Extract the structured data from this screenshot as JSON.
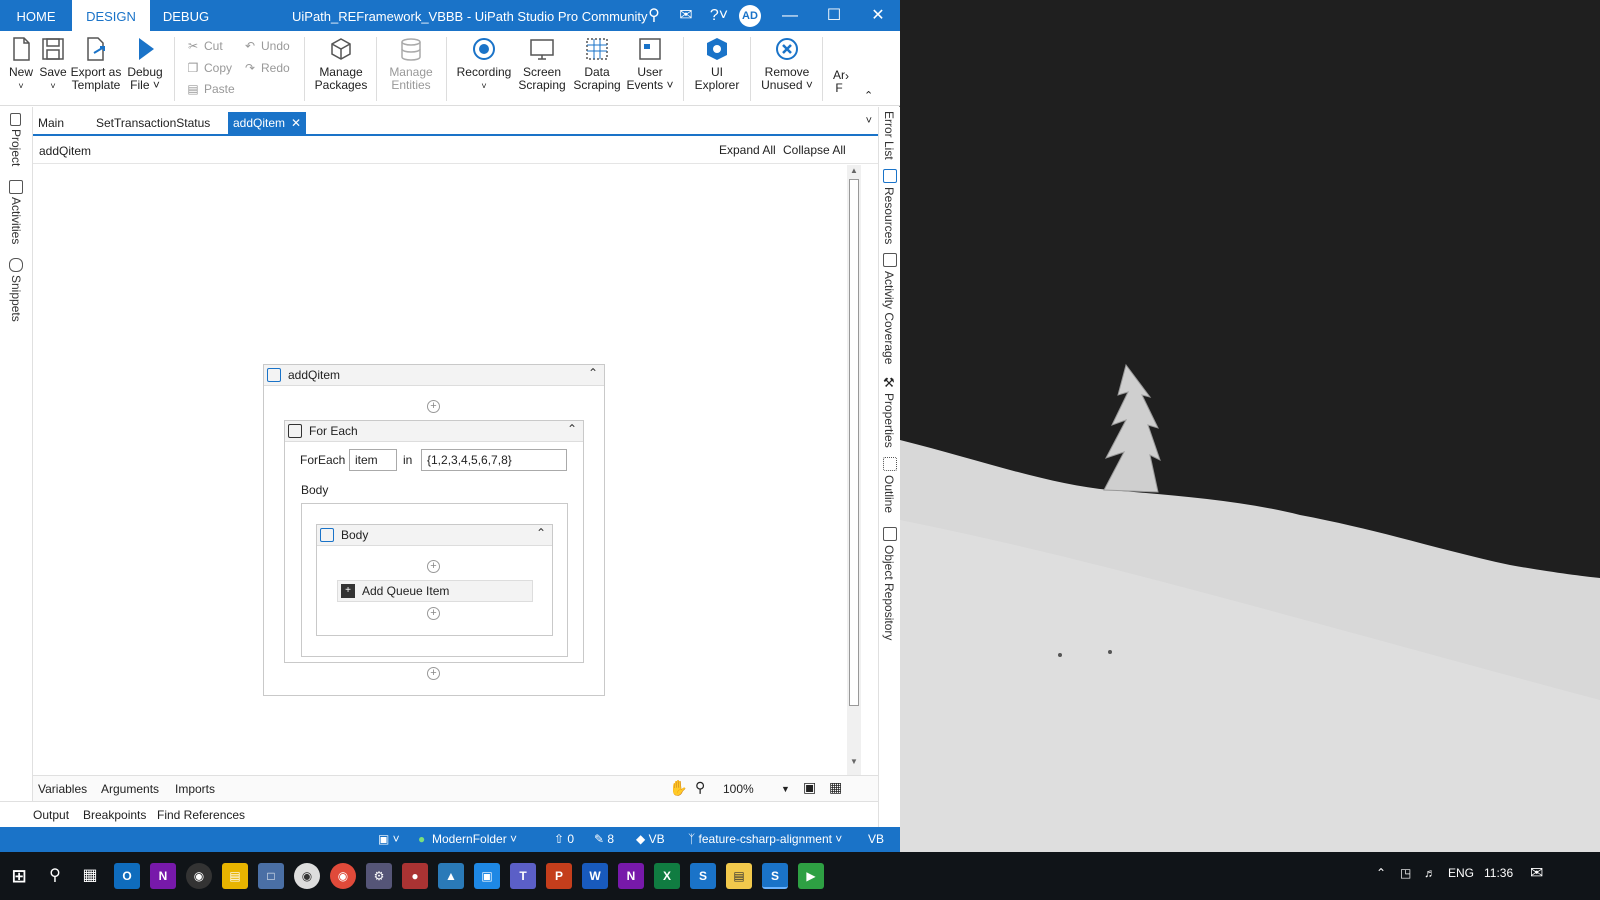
{
  "window": {
    "title": "UiPath_REFramework_VBBB - UiPath Studio Pro Community",
    "tabs": [
      "HOME",
      "DESIGN",
      "DEBUG"
    ],
    "active_tab": "DESIGN",
    "avatar": "AD",
    "accent_color": "#1a73c8"
  },
  "ribbon": {
    "new": "New",
    "save": "Save",
    "export_line1": "Export as",
    "export_line2": "Template",
    "debug_line1": "Debug",
    "debug_line2": "File",
    "cut": "Cut",
    "copy": "Copy",
    "paste": "Paste",
    "undo": "Undo",
    "redo": "Redo",
    "manage_packages_line1": "Manage",
    "manage_packages_line2": "Packages",
    "manage_entities_line1": "Manage",
    "manage_entities_line2": "Entities",
    "recording": "Recording",
    "screen_scraping_line1": "Screen",
    "screen_scraping_line2": "Scraping",
    "data_scraping_line1": "Data",
    "data_scraping_line2": "Scraping",
    "user_events_line1": "User",
    "user_events_line2": "Events",
    "ui_explorer_line1": "UI",
    "ui_explorer_line2": "Explorer",
    "remove_unused_line1": "Remove",
    "remove_unused_line2": "Unused",
    "overflow_line1": "Ar",
    "overflow_line2": "F"
  },
  "left_panels": [
    "Project",
    "Activities",
    "Snippets"
  ],
  "right_panels": [
    "Error List",
    "Resources",
    "Activity Coverage",
    "Properties",
    "Outline",
    "Object Repository"
  ],
  "doc_tabs": [
    "Main",
    "SetTransactionStatus",
    "addQitem"
  ],
  "breadcrumb": {
    "path": "addQitem",
    "expand_all": "Expand All",
    "collapse_all": "Collapse All"
  },
  "workflow": {
    "sequence_title": "addQitem",
    "foreach_title": "For Each",
    "foreach_label": "ForEach",
    "foreach_var": "item",
    "in_label": "in",
    "foreach_values": "{1,2,3,4,5,6,7,8}",
    "body_label": "Body",
    "body_seq_title": "Body",
    "activity": "Add Queue Item"
  },
  "bottom": {
    "variables": "Variables",
    "arguments": "Arguments",
    "imports": "Imports",
    "zoom": "100%",
    "output": "Output",
    "breakpoints": "Breakpoints",
    "find_references": "Find References"
  },
  "status": {
    "folder": "ModernFolder",
    "publish_count": "0",
    "edit_count": "8",
    "language": "VB",
    "branch": "feature-csharp-alignment",
    "lang_right": "VB"
  },
  "taskbar": {
    "lang": "ENG",
    "time": "11:36"
  }
}
